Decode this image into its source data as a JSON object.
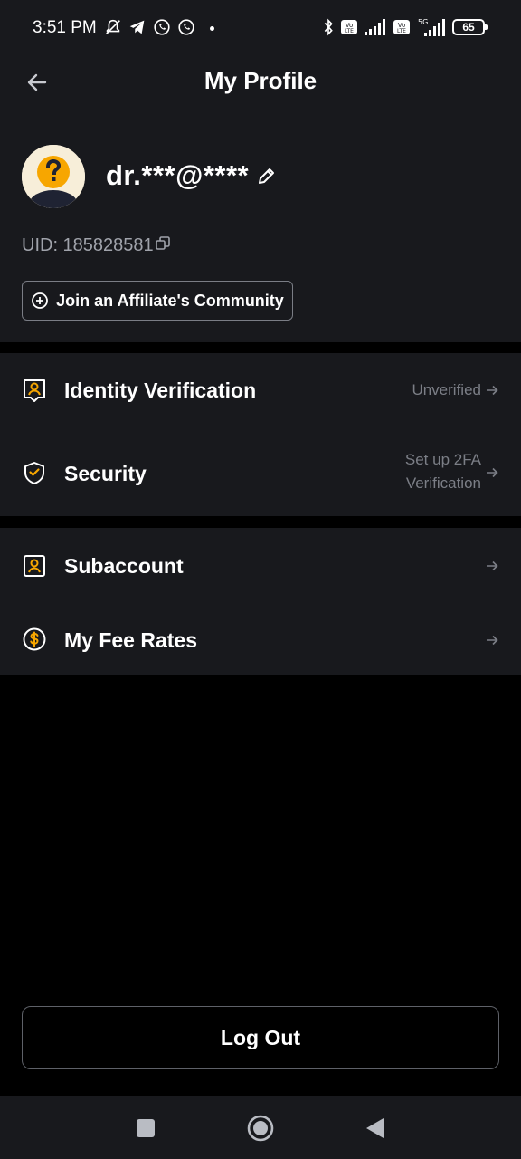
{
  "status_bar": {
    "time": "3:51 PM",
    "battery": "65",
    "network": "5G"
  },
  "header": {
    "title": "My Profile"
  },
  "profile": {
    "email": "dr.***@****",
    "uid": "UID: 185828581",
    "affiliate_button_label": "Join an Affiliate's Community"
  },
  "menu_section_1": [
    {
      "label": "Identity Verification",
      "status": "Unverified",
      "icon": "id-card-icon"
    },
    {
      "label": "Security",
      "status_line1": "Set up 2FA",
      "status_line2": "Verification",
      "icon": "shield-icon"
    }
  ],
  "menu_section_2": [
    {
      "label": "Subaccount",
      "icon": "user-badge-icon"
    },
    {
      "label": "My Fee Rates",
      "icon": "dollar-coin-icon"
    }
  ],
  "logout_label": "Log Out",
  "colors": {
    "background": "#000000",
    "panel": "#18191d",
    "accent": "#f7a600",
    "muted_text": "#7b7e86"
  }
}
